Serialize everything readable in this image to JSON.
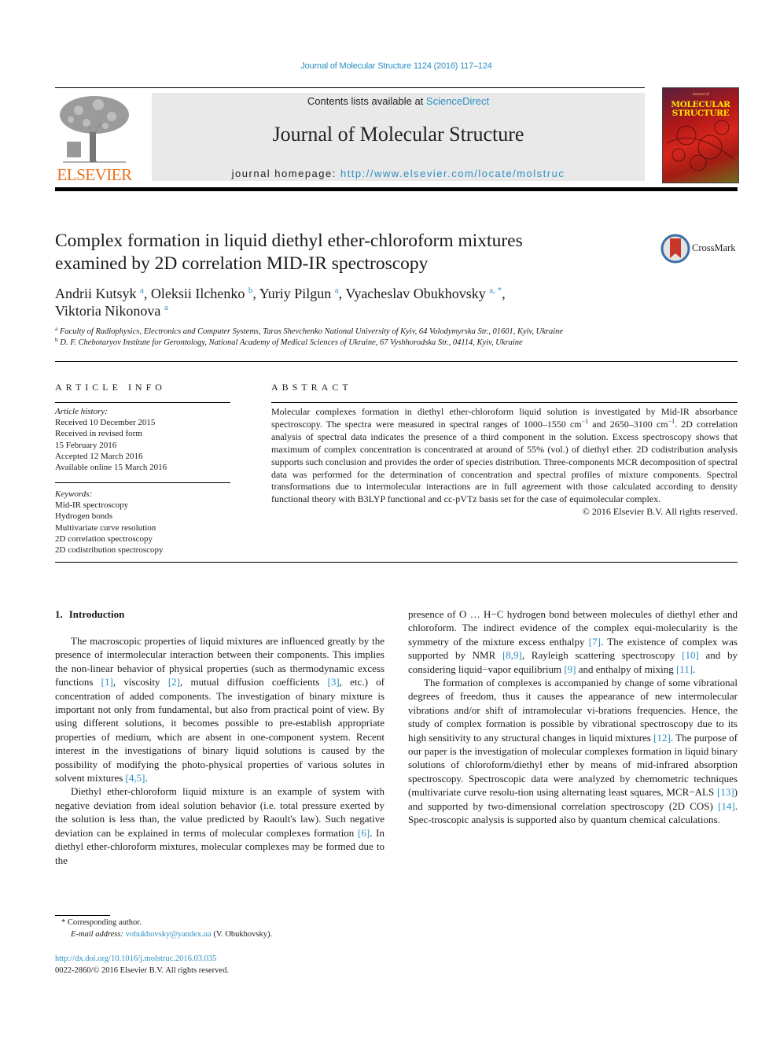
{
  "header": {
    "citation": "Journal of Molecular Structure 1124 (2016) 117–124",
    "publisher_wordmark": "ELSEVIER",
    "contents_prefix": "Contents lists available at ",
    "contents_link": "ScienceDirect",
    "journal_title": "Journal of Molecular Structure",
    "homepage_prefix": "journal homepage: ",
    "homepage_url": "http://www.elsevier.com/locate/molstruc",
    "cover": {
      "subtitle": "Journal of",
      "title_line1": "MOLECULAR",
      "title_line2": "STRUCTURE"
    }
  },
  "article": {
    "title_line1": "Complex formation in liquid diethyl ether-chloroform mixtures",
    "title_line2": "examined by 2D correlation MID-IR spectroscopy",
    "crossmark_label": "CrossMark",
    "authors": [
      {
        "name": "Andrii Kutsyk",
        "sup": "a",
        "sep": ", "
      },
      {
        "name": "Oleksii Ilchenko",
        "sup": "b",
        "sep": ", "
      },
      {
        "name": "Yuriy Pilgun",
        "sup": "a",
        "sep": ", "
      },
      {
        "name": "Vyacheslav Obukhovsky",
        "sup": "a, *",
        "sep": ","
      },
      {
        "name": "Viktoria Nikonova",
        "sup": "a",
        "sep": ""
      }
    ],
    "affiliations": [
      {
        "mark": "a",
        "text": "Faculty of Radiophysics, Electronics and Computer Systems, Taras Shevchenko National University of Kyiv, 64 Volodymyrska Str., 01601, Kyiv, Ukraine"
      },
      {
        "mark": "b",
        "text": "D. F. Chebotaryov Institute for Gerontology, National Academy of Medical Sciences of Ukraine, 67 Vyshhorodska Str., 04114, Kyiv, Ukraine"
      }
    ]
  },
  "article_info": {
    "heading": "ARTICLE INFO",
    "history_label": "Article history:",
    "history": [
      "Received 10 December 2015",
      "Received in revised form",
      "15 February 2016",
      "Accepted 12 March 2016",
      "Available online 15 March 2016"
    ],
    "keywords_label": "Keywords:",
    "keywords": [
      "Mid-IR spectroscopy",
      "Hydrogen bonds",
      "Multivariate curve resolution",
      "2D correlation spectroscopy",
      "2D codistribution spectroscopy"
    ]
  },
  "abstract": {
    "heading": "ABSTRACT",
    "part1": "Molecular complexes formation in diethyl ether-chloroform liquid solution is investigated by Mid-IR absorbance spectroscopy. The spectra were measured in spectral ranges of 1000–1550 cm",
    "sup1": "−1",
    "part2": " and 2650–3100 cm",
    "sup2": "−1",
    "part3": ". 2D correlation analysis of spectral data indicates the presence of a third component in the solution. Excess spectroscopy shows that maximum of complex concentration is concentrated at around of 55% (vol.) of diethyl ether. 2D codistribution analysis supports such conclusion and provides the order of species distribution. Three-components MCR decomposition of spectral data was performed for the determination of concentration and spectral profiles of mixture components. Spectral transformations due to intermolecular interactions are in full agreement with those calculated according to density functional theory with B3LYP functional and cc-pVTz basis set for the case of equimolecular complex.",
    "copyright": "© 2016 Elsevier B.V. All rights reserved."
  },
  "body": {
    "section_number": "1.",
    "section_title": "Introduction",
    "p1": [
      {
        "t": "The macroscopic properties of liquid mixtures are influenced greatly by the presence of intermolecular interaction between their components. This implies the non-linear behavior of physical properties (such as thermodynamic excess functions "
      },
      {
        "ref": "[1]"
      },
      {
        "t": ", viscosity "
      },
      {
        "ref": "[2]"
      },
      {
        "t": ", mutual diffusion coefficients "
      },
      {
        "ref": "[3]"
      },
      {
        "t": ", etc.) of concentration of added components. The investigation of binary mixture is important not only from fundamental, but also from practical point of view. By using different solutions, it becomes possible to pre-establish appropriate properties of medium, which are absent in one-component system. Recent interest in the investigations of binary liquid solutions is caused by the possibility of modifying the photo-physical properties of various solutes in solvent mixtures "
      },
      {
        "ref": "[4,5]"
      },
      {
        "t": "."
      }
    ],
    "p2": [
      {
        "t": "Diethyl ether-chloroform liquid mixture is an example of system with negative deviation from ideal solution behavior (i.e. total pressure exerted by the solution is less than, the value predicted by Raoult's law). Such negative deviation can be explained in terms of molecular complexes formation "
      },
      {
        "ref": "[6]"
      },
      {
        "t": ". In diethyl ether-chloroform mixtures, molecular complexes may be formed due to the"
      }
    ],
    "p3": [
      {
        "t": "presence of O … H−C hydrogen bond between molecules of diethyl ether and chloroform. The indirect evidence of the complex equi-molecularity is the symmetry of the mixture excess enthalpy "
      },
      {
        "ref": "[7]"
      },
      {
        "t": ". The existence of complex was supported by NMR "
      },
      {
        "ref": "[8,9]"
      },
      {
        "t": ", Rayleigh scattering spectroscopy "
      },
      {
        "ref": "[10]"
      },
      {
        "t": " and by considering liquid−vapor equilibrium "
      },
      {
        "ref": "[9]"
      },
      {
        "t": " and enthalpy of mixing "
      },
      {
        "ref": "[11]"
      },
      {
        "t": "."
      }
    ],
    "p4": [
      {
        "t": "The formation of complexes is accompanied by change of some vibrational degrees of freedom, thus it causes the appearance of new intermolecular vibrations and/or shift of intramolecular vi-brations frequencies. Hence, the study of complex formation is possible by vibrational spectroscopy due to its high sensitivity to any structural changes in liquid mixtures "
      },
      {
        "ref": "[12]"
      },
      {
        "t": ". The purpose of our paper is the investigation of molecular complexes formation in liquid binary solutions of chloroform/diethyl ether by means of mid-infrared absorption spectroscopy. Spectroscopic data were analyzed by chemometric techniques (multivariate curve resolu-tion using alternating least squares, MCR−ALS "
      },
      {
        "ref": "[13]"
      },
      {
        "t": ") and supported by two-dimensional correlation spectroscopy (2D COS) "
      },
      {
        "ref": "[14]"
      },
      {
        "t": ". Spec-troscopic analysis is supported also by quantum chemical calculations."
      }
    ]
  },
  "footer": {
    "footnote_mark": "*",
    "footnote_text": "Corresponding author.",
    "email_label": "E-mail address: ",
    "email": "vobukhovsky@yandex.ua",
    "email_suffix": " (V. Obukhovsky).",
    "doi_url": "http://dx.doi.org/10.1016/j.molstruc.2016.03.035",
    "issn_copyright": "0022-2860/© 2016 Elsevier B.V. All rights reserved."
  }
}
